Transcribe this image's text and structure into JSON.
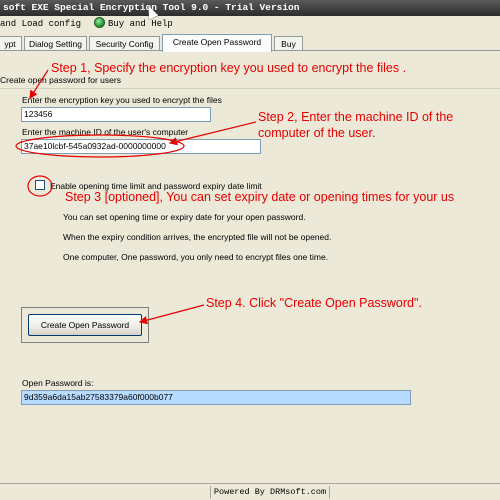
{
  "window": {
    "title": "soft EXE Special Encryption Tool 9.0 - Trial Version"
  },
  "menu": {
    "items": [
      "and Load config",
      "Buy and Help"
    ]
  },
  "tabs": [
    "ypt",
    "Dialog Setting",
    "Security Config",
    "Create Open Password",
    "Buy"
  ],
  "active_tab": "Create Open Password",
  "group": {
    "label": "Create open password for users"
  },
  "key": {
    "label": "Enter the encryption key you used to encrypt the files",
    "value": "123456"
  },
  "machine": {
    "label": "Enter  the machine ID of the user's computer",
    "value": "37ae10lcbf-545a0932ad-0000000000"
  },
  "limit": {
    "label": "Enable opening time limit and password expiry date limit",
    "checked": false
  },
  "info": [
    "You can set opening time or  expiry date for your open password.",
    "When the expiry condition arrives, the encrypted file will not be opened.",
    "One computer, One password, you only need to encrypt files one time."
  ],
  "create_button": {
    "label": "Create Open Password"
  },
  "result": {
    "label": "Open Password is:",
    "value": "9d359a6da15ab27583379a60f000b077"
  },
  "annotations": {
    "step1": "Step 1, Specify the encryption key you used to encrypt the files .",
    "step2_line1": "Step 2, Enter the machine ID of the",
    "step2_line2": "computer of the user.",
    "step3": "Step 3 [optioned], You can set expiry date or opening times for your us",
    "step4": "Step 4. Click \"Create Open Password\"."
  },
  "status": {
    "text": "Powered By DRMsoft.com"
  },
  "colors": {
    "annotation": "#e60000",
    "result_field": "#b8dcff"
  }
}
